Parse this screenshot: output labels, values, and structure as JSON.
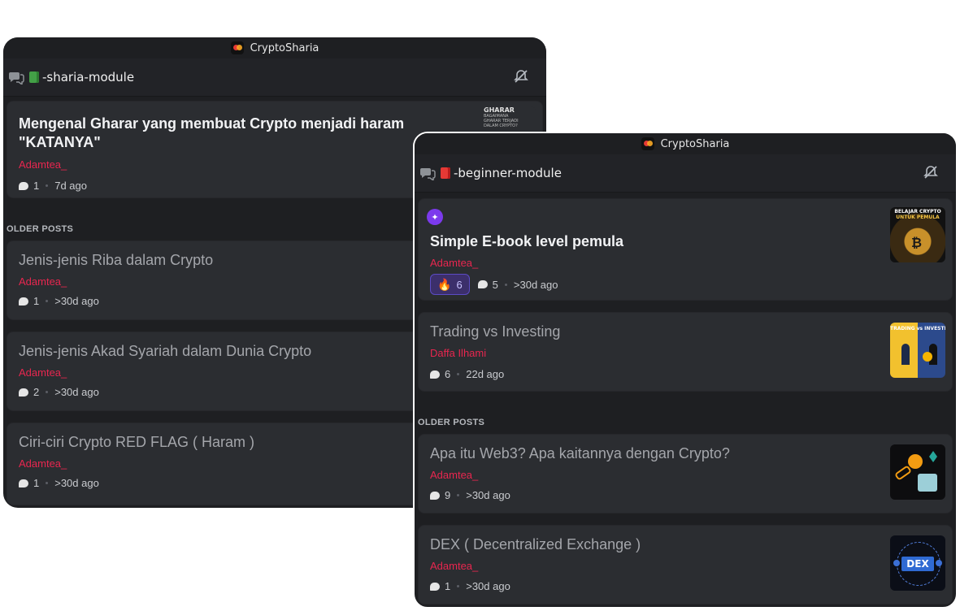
{
  "left_window": {
    "app_title": "CryptoSharia",
    "channel": "-sharia-module",
    "featured": {
      "title": "Mengenal Gharar yang membuat Crypto menjadi haram \"KATANYA\"",
      "author": "Adamtea_",
      "comments": "1",
      "time": "7d ago",
      "thumb_text": [
        "GHARAR",
        "BAGAIMANA",
        "GHARAR TERJADI",
        "DALAM CRYPTO?"
      ]
    },
    "section_label": "OLDER POSTS",
    "posts": [
      {
        "title": "Jenis-jenis Riba dalam Crypto",
        "author": "Adamtea_",
        "comments": "1",
        "time": ">30d ago"
      },
      {
        "title": "Jenis-jenis Akad Syariah dalam Dunia Crypto",
        "author": "Adamtea_",
        "comments": "2",
        "time": ">30d ago"
      },
      {
        "title": "Ciri-ciri Crypto RED FLAG ( Haram )",
        "author": "Adamtea_",
        "comments": "1",
        "time": ">30d ago"
      }
    ]
  },
  "right_window": {
    "app_title": "CryptoSharia",
    "channel": "-beginner-module",
    "pinned": {
      "title": "Simple E-book level pemula",
      "author": "Adamtea_",
      "reaction_count": "6",
      "comments": "5",
      "time": ">30d ago",
      "thumb_text": [
        "BELAJAR CRYPTO",
        "UNTUK PEMULA"
      ]
    },
    "second": {
      "title": "Trading vs Investing",
      "author": "Daffa Ilhami",
      "comments": "6",
      "time": "22d ago",
      "thumb_text": "TRADING vs INVESTING"
    },
    "section_label": "OLDER POSTS",
    "posts": [
      {
        "title": "Apa itu Web3? Apa kaitannya dengan Crypto?",
        "author": "Adamtea_",
        "comments": "9",
        "time": ">30d ago"
      },
      {
        "title": "DEX ( Decentralized Exchange )",
        "author": "Adamtea_",
        "comments": "1",
        "time": ">30d ago",
        "thumb_text": "DEX"
      }
    ]
  },
  "colors": {
    "author": "#e8264f",
    "background": "#1e1f22",
    "card": "#2b2d31"
  }
}
